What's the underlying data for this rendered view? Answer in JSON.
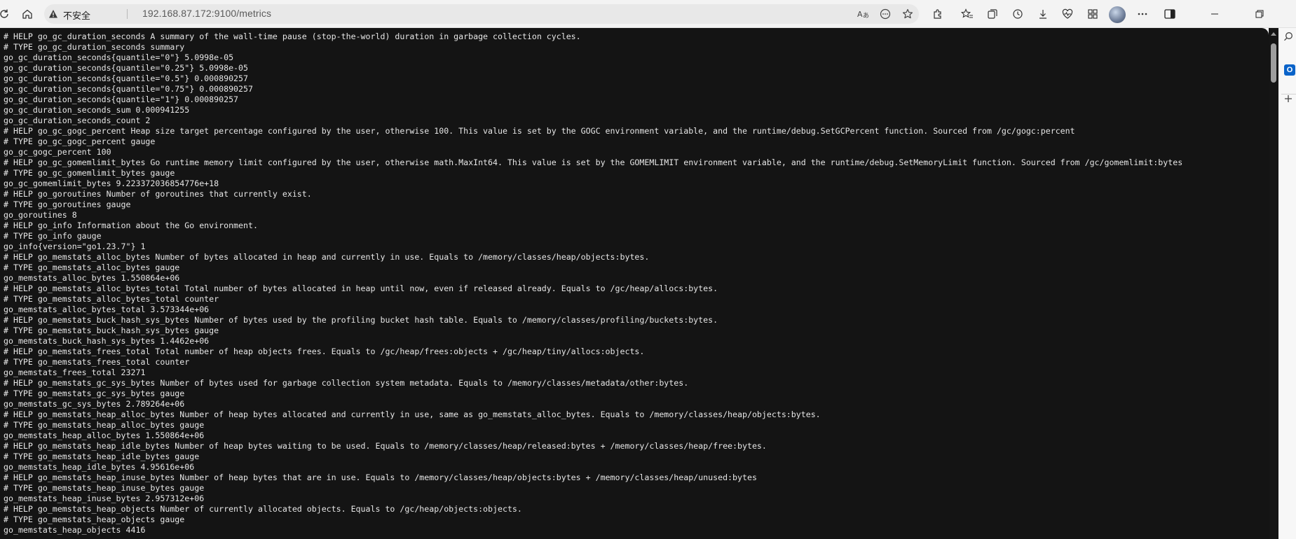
{
  "browser": {
    "security_label": "不安全",
    "url": "192.168.87.172:9100/metrics",
    "icons": {
      "refresh": "refresh-icon",
      "home": "home-icon",
      "warning": "warning-triangle-icon",
      "read_aloud": "read-aloud-icon",
      "more_page": "page-options-icon",
      "favorite": "star-icon",
      "extensions": "puzzle-icon",
      "favorites": "favorites-icon",
      "collections": "collections-icon",
      "history": "history-icon",
      "downloads": "download-icon",
      "performance": "heartbeat-icon",
      "apps": "apps-icon",
      "settings_more": "more-icon",
      "sidebar_toggle": "sidebar-icon",
      "minimize": "minimize-icon",
      "maximize": "restore-icon",
      "close": "close-icon",
      "search_side": "search-icon",
      "outlook": "outlook-icon",
      "add_side": "plus-icon"
    },
    "colors": {
      "page_bg": "#141414",
      "text": "#e6e6e6",
      "toolbar_bg": "#f3f3f3",
      "address_bg": "#e8e8e8"
    }
  },
  "metrics_lines": [
    "# HELP go_gc_duration_seconds A summary of the wall-time pause (stop-the-world) duration in garbage collection cycles.",
    "# TYPE go_gc_duration_seconds summary",
    "go_gc_duration_seconds{quantile=\"0\"} 5.0998e-05",
    "go_gc_duration_seconds{quantile=\"0.25\"} 5.0998e-05",
    "go_gc_duration_seconds{quantile=\"0.5\"} 0.000890257",
    "go_gc_duration_seconds{quantile=\"0.75\"} 0.000890257",
    "go_gc_duration_seconds{quantile=\"1\"} 0.000890257",
    "go_gc_duration_seconds_sum 0.000941255",
    "go_gc_duration_seconds_count 2",
    "# HELP go_gc_gogc_percent Heap size target percentage configured by the user, otherwise 100. This value is set by the GOGC environment variable, and the runtime/debug.SetGCPercent function. Sourced from /gc/gogc:percent",
    "# TYPE go_gc_gogc_percent gauge",
    "go_gc_gogc_percent 100",
    "# HELP go_gc_gomemlimit_bytes Go runtime memory limit configured by the user, otherwise math.MaxInt64. This value is set by the GOMEMLIMIT environment variable, and the runtime/debug.SetMemoryLimit function. Sourced from /gc/gomemlimit:bytes",
    "# TYPE go_gc_gomemlimit_bytes gauge",
    "go_gc_gomemlimit_bytes 9.223372036854776e+18",
    "# HELP go_goroutines Number of goroutines that currently exist.",
    "# TYPE go_goroutines gauge",
    "go_goroutines 8",
    "# HELP go_info Information about the Go environment.",
    "# TYPE go_info gauge",
    "go_info{version=\"go1.23.7\"} 1",
    "# HELP go_memstats_alloc_bytes Number of bytes allocated in heap and currently in use. Equals to /memory/classes/heap/objects:bytes.",
    "# TYPE go_memstats_alloc_bytes gauge",
    "go_memstats_alloc_bytes 1.550864e+06",
    "# HELP go_memstats_alloc_bytes_total Total number of bytes allocated in heap until now, even if released already. Equals to /gc/heap/allocs:bytes.",
    "# TYPE go_memstats_alloc_bytes_total counter",
    "go_memstats_alloc_bytes_total 3.573344e+06",
    "# HELP go_memstats_buck_hash_sys_bytes Number of bytes used by the profiling bucket hash table. Equals to /memory/classes/profiling/buckets:bytes.",
    "# TYPE go_memstats_buck_hash_sys_bytes gauge",
    "go_memstats_buck_hash_sys_bytes 1.4462e+06",
    "# HELP go_memstats_frees_total Total number of heap objects frees. Equals to /gc/heap/frees:objects + /gc/heap/tiny/allocs:objects.",
    "# TYPE go_memstats_frees_total counter",
    "go_memstats_frees_total 23271",
    "# HELP go_memstats_gc_sys_bytes Number of bytes used for garbage collection system metadata. Equals to /memory/classes/metadata/other:bytes.",
    "# TYPE go_memstats_gc_sys_bytes gauge",
    "go_memstats_gc_sys_bytes 2.789264e+06",
    "# HELP go_memstats_heap_alloc_bytes Number of heap bytes allocated and currently in use, same as go_memstats_alloc_bytes. Equals to /memory/classes/heap/objects:bytes.",
    "# TYPE go_memstats_heap_alloc_bytes gauge",
    "go_memstats_heap_alloc_bytes 1.550864e+06",
    "# HELP go_memstats_heap_idle_bytes Number of heap bytes waiting to be used. Equals to /memory/classes/heap/released:bytes + /memory/classes/heap/free:bytes.",
    "# TYPE go_memstats_heap_idle_bytes gauge",
    "go_memstats_heap_idle_bytes 4.95616e+06",
    "# HELP go_memstats_heap_inuse_bytes Number of heap bytes that are in use. Equals to /memory/classes/heap/objects:bytes + /memory/classes/heap/unused:bytes",
    "# TYPE go_memstats_heap_inuse_bytes gauge",
    "go_memstats_heap_inuse_bytes 2.957312e+06",
    "# HELP go_memstats_heap_objects Number of currently allocated objects. Equals to /gc/heap/objects:objects.",
    "# TYPE go_memstats_heap_objects gauge",
    "go_memstats_heap_objects 4416"
  ]
}
